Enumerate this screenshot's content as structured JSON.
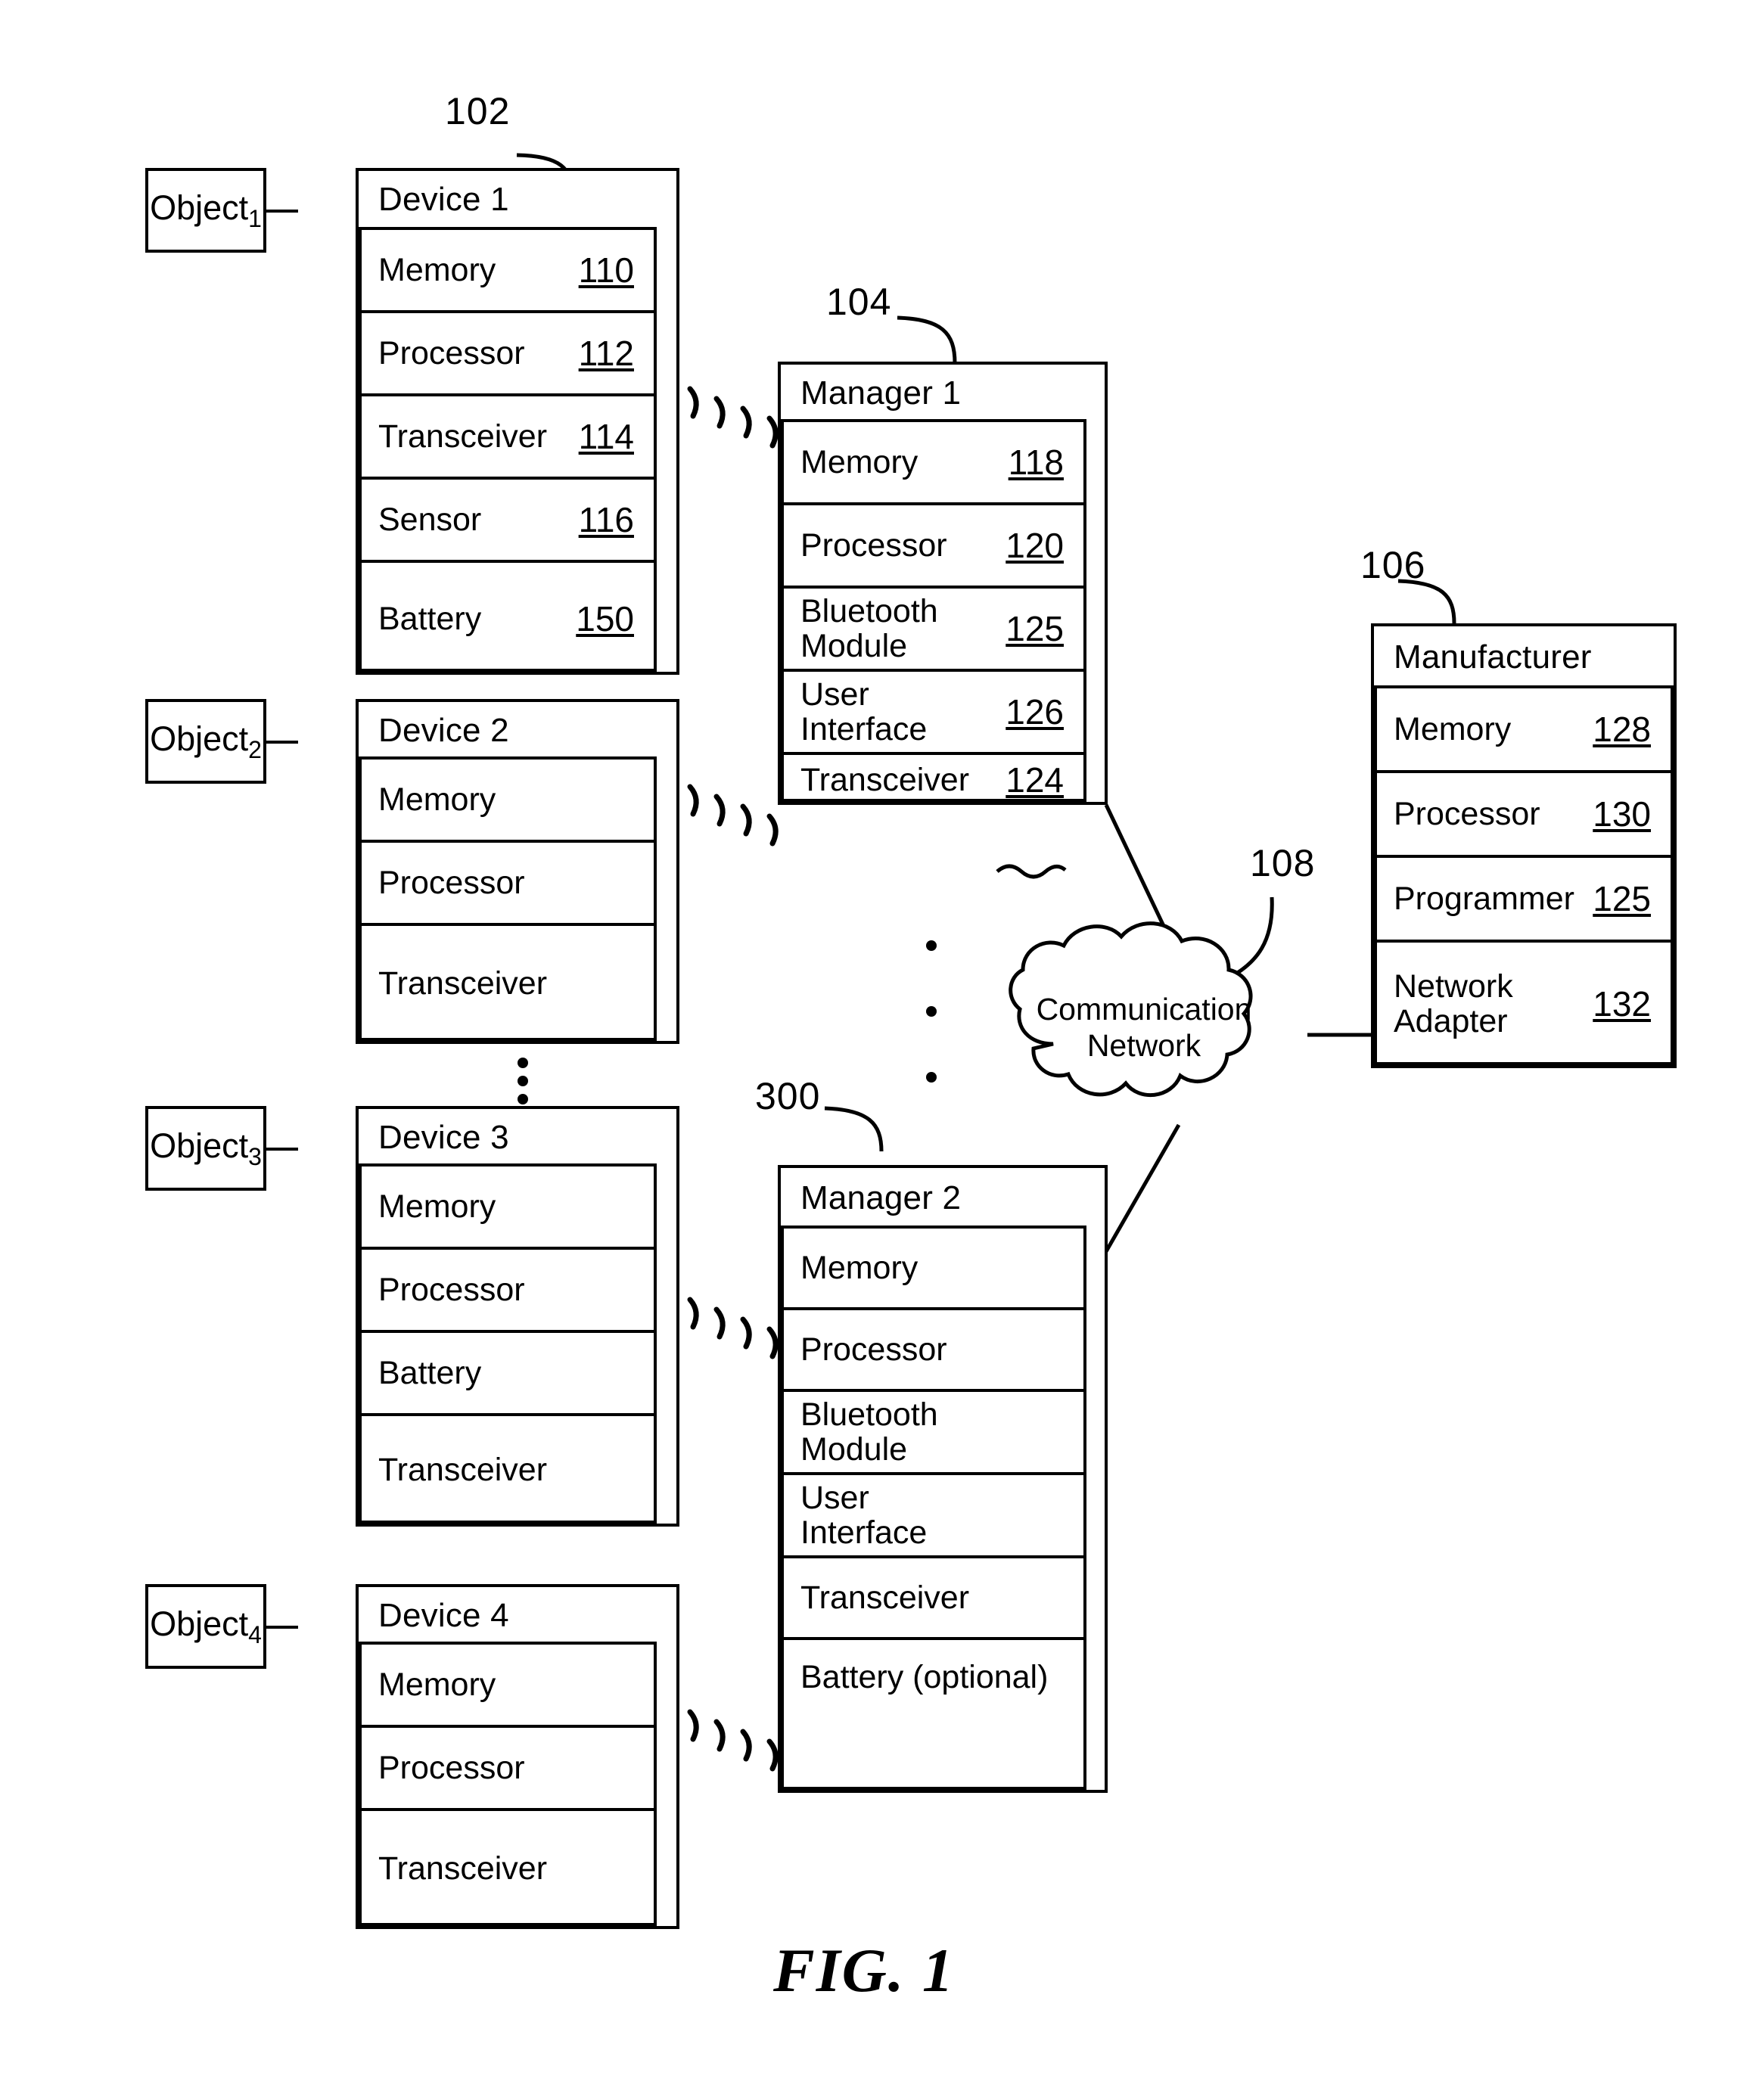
{
  "figure": {
    "caption": "FIG. 1"
  },
  "objects": [
    {
      "name": "Object",
      "index": "1"
    },
    {
      "name": "Object",
      "index": "2"
    },
    {
      "name": "Object",
      "index": "3"
    },
    {
      "name": "Object",
      "index": "4"
    }
  ],
  "devices": [
    {
      "title": "Device 1",
      "ref": "102",
      "rows": [
        {
          "label": "Memory",
          "num": "110"
        },
        {
          "label": "Processor",
          "num": "112"
        },
        {
          "label": "Transceiver",
          "num": "114"
        },
        {
          "label": "Sensor",
          "num": "116"
        },
        {
          "label": "Battery",
          "num": "150"
        }
      ]
    },
    {
      "title": "Device 2",
      "ref": "",
      "rows": [
        {
          "label": "Memory",
          "num": ""
        },
        {
          "label": "Processor",
          "num": ""
        },
        {
          "label": "Transceiver",
          "num": ""
        }
      ]
    },
    {
      "title": "Device 3",
      "ref": "",
      "rows": [
        {
          "label": "Memory",
          "num": ""
        },
        {
          "label": "Processor",
          "num": ""
        },
        {
          "label": "Battery",
          "num": ""
        },
        {
          "label": "Transceiver",
          "num": ""
        }
      ]
    },
    {
      "title": "Device 4",
      "ref": "",
      "rows": [
        {
          "label": "Memory",
          "num": ""
        },
        {
          "label": "Processor",
          "num": ""
        },
        {
          "label": "Transceiver",
          "num": ""
        }
      ]
    }
  ],
  "managers": [
    {
      "title": "Manager 1",
      "ref": "104",
      "rows": [
        {
          "label": "Memory",
          "num": "118"
        },
        {
          "label": "Processor",
          "num": "120"
        },
        {
          "label": "Bluetooth\nModule",
          "num": "125"
        },
        {
          "label": "User\nInterface",
          "num": "126"
        },
        {
          "label": "Transceiver",
          "num": "124"
        }
      ]
    },
    {
      "title": "Manager 2",
      "ref": "300",
      "rows": [
        {
          "label": "Memory",
          "num": ""
        },
        {
          "label": "Processor",
          "num": ""
        },
        {
          "label": "Bluetooth\nModule",
          "num": ""
        },
        {
          "label": "User\nInterface",
          "num": ""
        },
        {
          "label": "Transceiver",
          "num": ""
        },
        {
          "label": "Battery (optional)",
          "num": ""
        }
      ]
    }
  ],
  "manufacturer": {
    "title": "Manufacturer",
    "ref": "106",
    "rows": [
      {
        "label": "Memory",
        "num": "128"
      },
      {
        "label": "Processor",
        "num": "130"
      },
      {
        "label": "Programmer",
        "num": "125"
      },
      {
        "label": "Network\nAdapter",
        "num": "132"
      }
    ]
  },
  "network": {
    "line1": "Communication",
    "line2": "Network",
    "ref": "108"
  },
  "colors": {
    "ink": "#000000",
    "paper": "#ffffff"
  }
}
